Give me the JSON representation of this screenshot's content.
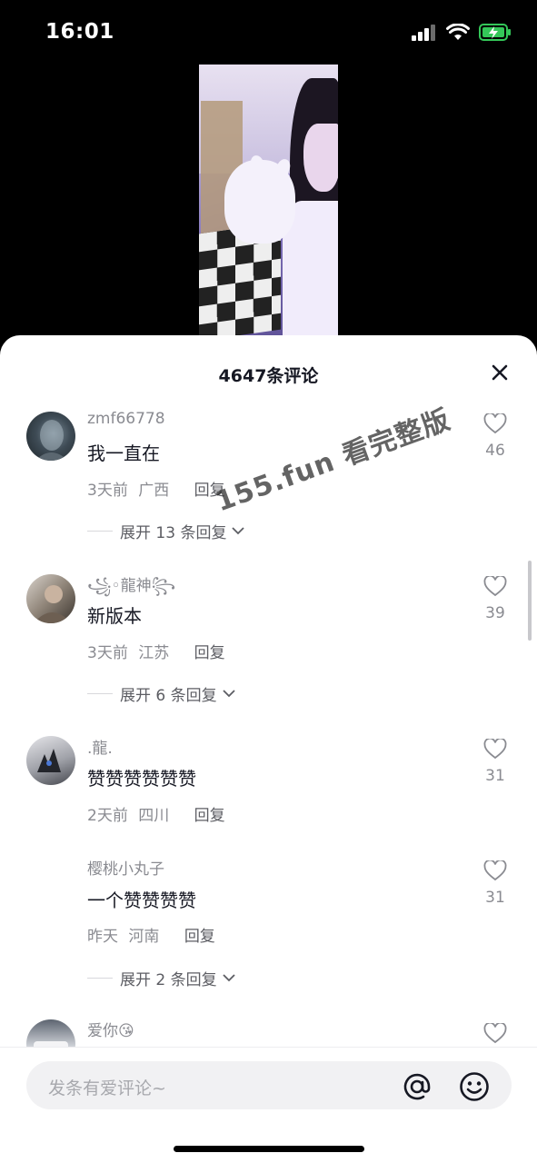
{
  "status_bar": {
    "time": "16:01"
  },
  "sheet": {
    "title": "4647条评论"
  },
  "comments": [
    {
      "username": "zmf66778",
      "text": "我一直在",
      "date": "3天前",
      "location": "广西",
      "reply": "回复",
      "expand": "展开 13 条回复",
      "likes": "46"
    },
    {
      "username": "꧁◦龍神꧂",
      "text": "新版本",
      "date": "3天前",
      "location": "江苏",
      "reply": "回复",
      "expand": "展开 6 条回复",
      "likes": "39"
    },
    {
      "username": ".龍.",
      "text": "赞赞赞赞赞赞",
      "date": "2天前",
      "location": "四川",
      "reply": "回复",
      "likes": "31"
    },
    {
      "username": "樱桃小丸子",
      "text": "一个赞赞赞赞",
      "date": "昨天",
      "location": "河南",
      "reply": "回复",
      "expand": "展开 2 条回复",
      "likes": "31"
    },
    {
      "username": "爱你😘"
    }
  ],
  "watermark": "155.fun 看完整版",
  "input": {
    "placeholder": "发条有爱评论~"
  },
  "icons": {
    "close": "close-icon",
    "like": "heart-outline-icon",
    "mention": "at-icon",
    "emoji": "smiley-icon",
    "chevron": "chevron-down-icon"
  },
  "colors": {
    "battery": "#34c759",
    "text_primary": "#161823",
    "text_secondary": "#8a8b91"
  }
}
